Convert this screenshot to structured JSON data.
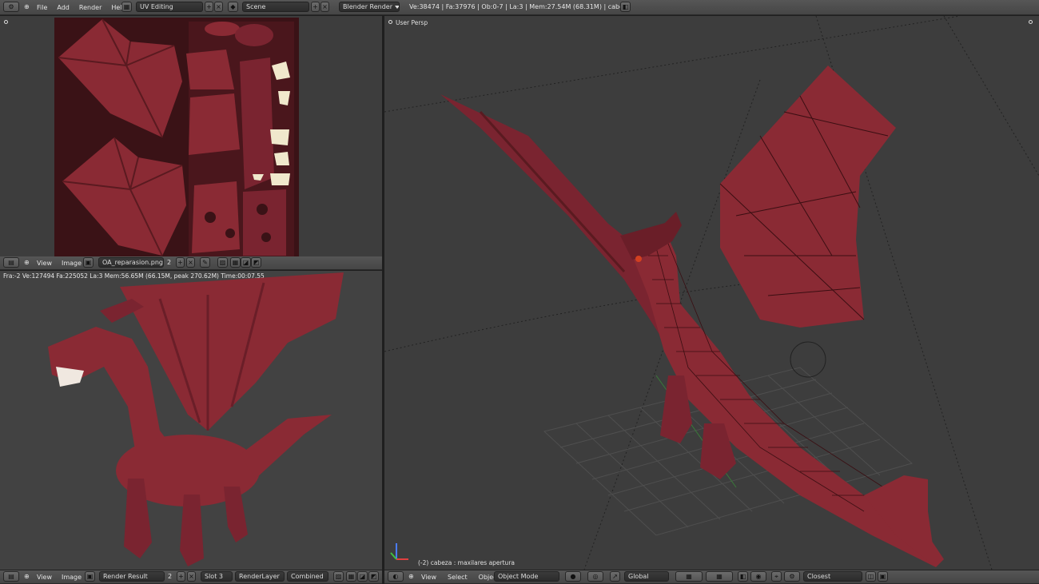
{
  "top": {
    "menus": [
      "File",
      "Add",
      "Render",
      "Help"
    ],
    "layout": "UV Editing",
    "scene": "Scene",
    "engine": "Blender Render",
    "stats": "Ve:38474 | Fa:37976 | Ob:0-7 | La:3 | Mem:27.54M (68.31M) | cabeza"
  },
  "uv_editor": {
    "menus": [
      "View",
      "Image"
    ],
    "image_name": "OA_reparasion.png",
    "users": "2"
  },
  "render_view": {
    "info": "Fra:-2  Ve:127494 Fa:225052 La:3 Mem:56.65M (66.15M, peak 270.62M) Time:00:07.55",
    "menus": [
      "View",
      "Image"
    ],
    "image_name": "Render Result",
    "users": "2",
    "slot": "Slot 3",
    "layer": "RenderLayer",
    "pass": "Combined"
  },
  "viewport3d": {
    "label": "User Persp",
    "object_info": "(-2) cabeza : maxilares apertura",
    "menus": [
      "View",
      "Select",
      "Object"
    ],
    "mode": "Object Mode",
    "orientation": "Global",
    "snap": "Closest"
  },
  "colors": {
    "dragon": "#8a2a34",
    "uv_bg": "#3a1216",
    "viewport_bg": "#3d3d3d"
  }
}
